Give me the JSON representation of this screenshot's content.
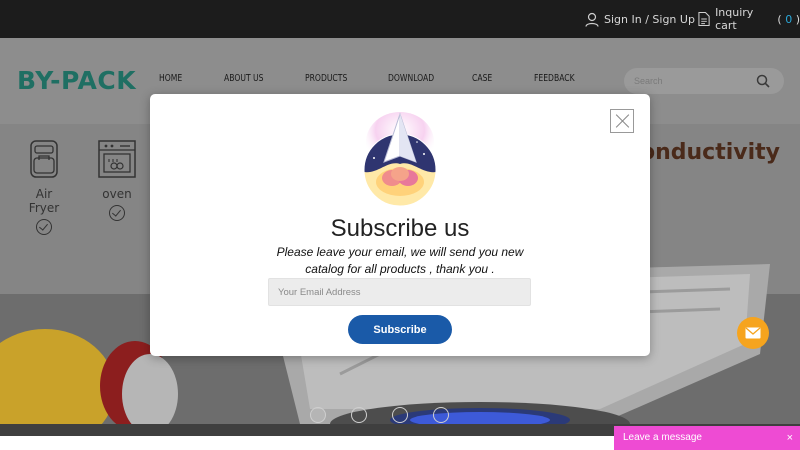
{
  "topbar": {
    "signin_label": "Sign In / Sign Up",
    "cart_label": "Inquiry cart",
    "cart_open": " ( ",
    "cart_count": "0",
    "cart_close": " )"
  },
  "header": {
    "logo": "BY-PACK",
    "nav": [
      "HOME",
      "ABOUT US",
      "PRODUCTS",
      "DOWNLOAD",
      "CASE",
      "FEEDBACK"
    ],
    "search_placeholder": "Search"
  },
  "hero": {
    "features": [
      {
        "label": "Air Fryer",
        "icon": "air-fryer-icon"
      },
      {
        "label": "oven",
        "icon": "oven-icon"
      }
    ],
    "tagline_fragment": "onductivity",
    "slides": 4,
    "active_slide": 1
  },
  "modal": {
    "title": "Subscribe us",
    "description": "Please leave your email, we will send you new catalog for all products , thank you .",
    "email_placeholder": "Your Email Address",
    "subscribe_label": "Subscribe"
  },
  "widgets": {
    "leave_message": "Leave a message",
    "close_glyph": "×"
  },
  "colors": {
    "topbar": "#1c1c1c",
    "logo": "#1f6f63",
    "subscribe_button": "#1a5aa8",
    "mail_fab": "#f6a41e",
    "leave_message_bar": "#ee4bd3",
    "cart_count": "#2aa7d8"
  }
}
